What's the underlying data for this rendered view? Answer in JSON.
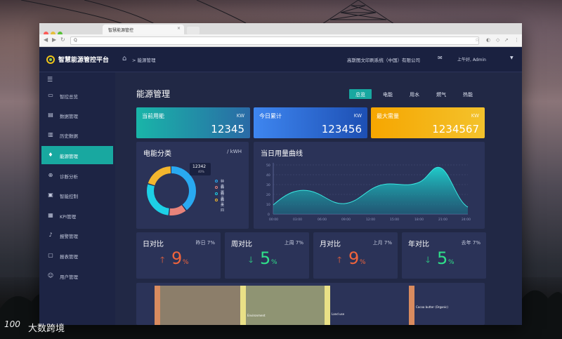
{
  "browser": {
    "tab_title": "智慧能源管控",
    "url": "Q",
    "tab_close": "×"
  },
  "app": {
    "title": "智慧能源管控平台",
    "breadcrumb": "> 能源管理",
    "company": "高斯图文印刷系统（中国）有限公司",
    "greeting": "上午好,  Admin",
    "icons": {
      "logo": "logo-icon",
      "home": "home-icon",
      "mail": "mail-icon",
      "menu": "menu-icon",
      "user_caret": "caret-down-icon"
    }
  },
  "sidebar": {
    "items": [
      {
        "label": "智控总览",
        "icon": "monitor-icon"
      },
      {
        "label": "数据管理",
        "icon": "document-icon"
      },
      {
        "label": "历史数据",
        "icon": "bar-chart-icon"
      },
      {
        "label": "能源管理",
        "icon": "droplet-icon",
        "active": true
      },
      {
        "label": "诊断分析",
        "icon": "diagnosis-icon"
      },
      {
        "label": "智能控制",
        "icon": "control-icon"
      },
      {
        "label": "KPI管理",
        "icon": "kpi-icon"
      },
      {
        "label": "报警管理",
        "icon": "bell-icon"
      },
      {
        "label": "报表管理",
        "icon": "report-icon"
      },
      {
        "label": "用户管理",
        "icon": "user-icon"
      }
    ]
  },
  "main": {
    "title": "能源管理",
    "tabs": [
      {
        "label": "总览",
        "active": true
      },
      {
        "label": "电能"
      },
      {
        "label": "用水"
      },
      {
        "label": "燃气"
      },
      {
        "label": "热能"
      }
    ],
    "kpis": [
      {
        "label": "当前用能",
        "unit": "KW",
        "value": "12345",
        "color_from": "#19b5a8",
        "color_to": "#1f6fa6"
      },
      {
        "label": "今日累计",
        "unit": "KW",
        "value": "123456",
        "color_from": "#3a7be8",
        "color_to": "#1d4fb3"
      },
      {
        "label": "最大需量",
        "unit": "KW",
        "value": "1234567",
        "color_from": "#f6a600",
        "color_to": "#f2c12e"
      }
    ],
    "donut": {
      "title": "电能分类",
      "unit": "/ kWH",
      "tooltip_value": "12342",
      "tooltip_pct": "40%",
      "legend": [
        {
          "label": "种类一",
          "color": "#29a9f0"
        },
        {
          "label": "种类二",
          "color": "#e8837a"
        },
        {
          "label": "种类三",
          "color": "#1dd0e6"
        },
        {
          "label": "种类四",
          "color": "#f3b62e"
        }
      ],
      "values": [
        40,
        12,
        28,
        20
      ]
    },
    "curve": {
      "title": "当日用量曲线",
      "y_ticks": [
        "50",
        "40",
        "30",
        "20",
        "10",
        "0"
      ],
      "x_ticks": [
        "00:00",
        "03:00",
        "06:00",
        "09:00",
        "12:00",
        "15:00",
        "18:00",
        "21:00",
        "24:00"
      ]
    },
    "comparisons": [
      {
        "title": "日对比",
        "ref": "昨日 7%",
        "dir": "up",
        "arrow": "🡑",
        "num": "9",
        "pct": "%",
        "color": "#f0643c"
      },
      {
        "title": "周对比",
        "ref": "上周 7%",
        "dir": "down",
        "arrow": "🡓",
        "num": "5",
        "pct": "%",
        "color": "#2fe08a"
      },
      {
        "title": "月对比",
        "ref": "上月 7%",
        "dir": "up",
        "arrow": "🡑",
        "num": "9",
        "pct": "%",
        "color": "#f0643c"
      },
      {
        "title": "年对比",
        "ref": "去年 7%",
        "dir": "down",
        "arrow": "🡓",
        "num": "5",
        "pct": "%",
        "color": "#2fe08a"
      }
    ],
    "bottom_labels": {
      "environment": "Environment",
      "land_use": "Land use",
      "cocoa": "Cocoa butter (Organic)"
    }
  },
  "watermark": {
    "logo_text": "100",
    "text": "大数跨境"
  }
}
